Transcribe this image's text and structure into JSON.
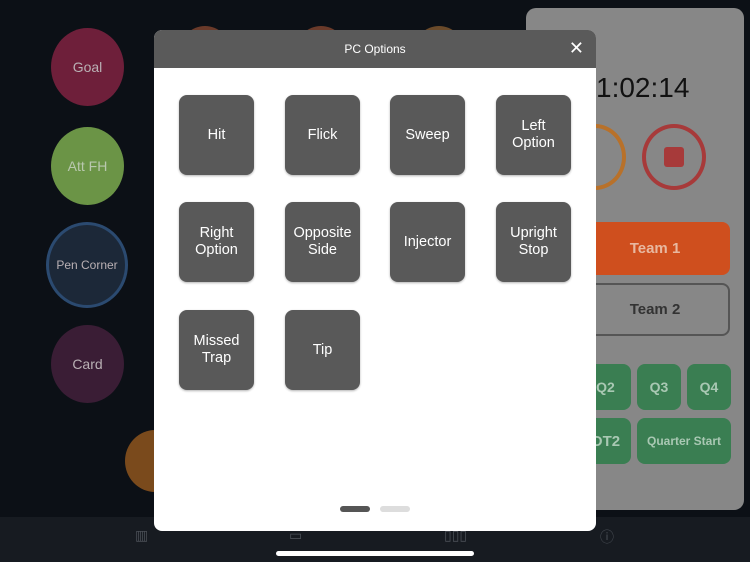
{
  "left_actions": [
    {
      "label": "Goal",
      "color": "#6e1f3a"
    },
    {
      "label": "Att FH",
      "color": "#6b9446"
    },
    {
      "label": "Pen Corner",
      "color": "#1c2838"
    },
    {
      "label": "Card",
      "color": "#3a1d35"
    }
  ],
  "right_panel": {
    "timer": "1:02:14",
    "team1": "Team 1",
    "team2": "Team 2",
    "quarters": [
      "Q2",
      "Q3",
      "Q4"
    ],
    "ot": "OT2",
    "quarter_start": "Quarter Start",
    "accent_orange": "#d9531e",
    "green": "#3a7e52"
  },
  "modal": {
    "title": "PC Options",
    "options": [
      "Hit",
      "Flick",
      "Sweep",
      "Left\nOption",
      "Right\nOption",
      "Opposite\nSide",
      "Injector",
      "Upright\nStop",
      "Missed\nTrap",
      "Tip"
    ],
    "page": 1,
    "pages": 2
  },
  "tabbar": {
    "icons": [
      "field-icon",
      "card-icon",
      "columns-icon",
      "info-icon"
    ]
  }
}
